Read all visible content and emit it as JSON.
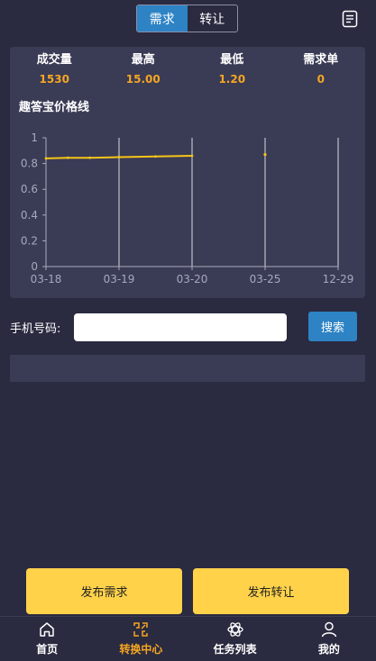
{
  "header": {
    "tabs": [
      {
        "label": "需求",
        "active": true
      },
      {
        "label": "转让",
        "active": false
      }
    ],
    "doc_icon": "document-icon"
  },
  "stats": [
    {
      "label": "成交量",
      "value": "1530"
    },
    {
      "label": "最高",
      "value": "15.00"
    },
    {
      "label": "最低",
      "value": "1.20"
    },
    {
      "label": "需求单",
      "value": "0"
    }
  ],
  "chart_title": "趣答宝价格线",
  "chart_data": {
    "type": "line",
    "title": "趣答宝价格线",
    "x_ticks": [
      "03-18",
      "03-19",
      "03-20",
      "03-25",
      "12-29"
    ],
    "y_ticks": [
      "0",
      "0.2",
      "0.4",
      "0.6",
      "0.8",
      "1"
    ],
    "ylim": [
      0,
      1
    ],
    "series": [
      {
        "points": [
          {
            "x": 0,
            "y": 0.84
          },
          {
            "x": 0.3,
            "y": 0.845
          },
          {
            "x": 0.6,
            "y": 0.845
          },
          {
            "x": 1,
            "y": 0.85
          },
          {
            "x": 1.5,
            "y": 0.855
          },
          {
            "x": 2,
            "y": 0.86
          }
        ]
      },
      {
        "points": [
          {
            "x": 3,
            "y": 0.87
          }
        ]
      }
    ],
    "vertical_gridlines_at": [
      1,
      2,
      3,
      4
    ],
    "line_color": "#f5c518"
  },
  "search": {
    "label": "手机号码:",
    "placeholder": "",
    "value": "",
    "button_label": "搜索"
  },
  "actions": {
    "publish_demand": "发布需求",
    "publish_transfer": "发布转让"
  },
  "nav": [
    {
      "label": "首页",
      "icon": "home-icon",
      "active": false
    },
    {
      "label": "转换中心",
      "icon": "exchange-icon",
      "active": true
    },
    {
      "label": "任务列表",
      "icon": "atom-icon",
      "active": false
    },
    {
      "label": "我的",
      "icon": "user-icon",
      "active": false
    }
  ],
  "colors": {
    "background": "#2a2a40",
    "card": "#3a3b55",
    "accent_blue": "#2d83c4",
    "accent_yellow": "#ffd24a",
    "value_orange": "#f5a623"
  }
}
